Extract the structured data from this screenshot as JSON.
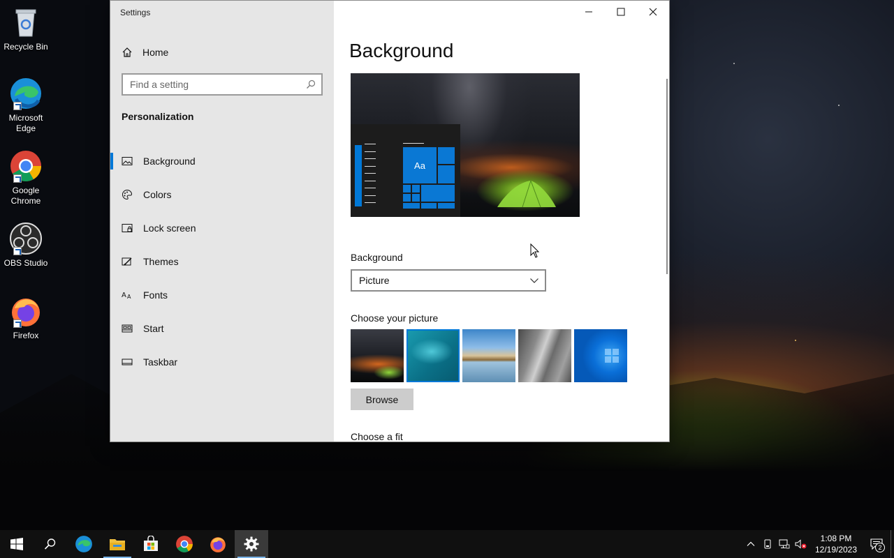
{
  "desktop": {
    "icons": [
      {
        "label": "Recycle Bin",
        "icon": "recycle-bin-icon"
      },
      {
        "label": "Microsoft Edge",
        "icon": "edge-icon"
      },
      {
        "label": "Google Chrome",
        "icon": "chrome-icon"
      },
      {
        "label": "OBS Studio",
        "icon": "obs-icon"
      },
      {
        "label": "Firefox",
        "icon": "firefox-icon"
      }
    ]
  },
  "window": {
    "title": "Settings",
    "home_label": "Home",
    "search_placeholder": "Find a setting",
    "section": "Personalization",
    "nav": [
      {
        "label": "Background",
        "icon": "picture-icon",
        "active": true
      },
      {
        "label": "Colors",
        "icon": "palette-icon",
        "active": false
      },
      {
        "label": "Lock screen",
        "icon": "lock-screen-icon",
        "active": false
      },
      {
        "label": "Themes",
        "icon": "themes-icon",
        "active": false
      },
      {
        "label": "Fonts",
        "icon": "fonts-icon",
        "active": false
      },
      {
        "label": "Start",
        "icon": "start-icon",
        "active": false
      },
      {
        "label": "Taskbar",
        "icon": "taskbar-icon",
        "active": false
      }
    ]
  },
  "content": {
    "title": "Background",
    "preview_tile_text": "Aa",
    "background_label": "Background",
    "background_value": "Picture",
    "choose_picture_label": "Choose your picture",
    "browse_label": "Browse",
    "choose_fit_label": "Choose a fit",
    "selected_picture_index": 1
  },
  "taskbar": {
    "time": "1:08 PM",
    "date": "12/19/2023",
    "notification_count": "2"
  },
  "colors": {
    "accent": "#0078d7",
    "sidebar_bg": "#e6e6e6",
    "taskbar_bg": "#101010"
  }
}
